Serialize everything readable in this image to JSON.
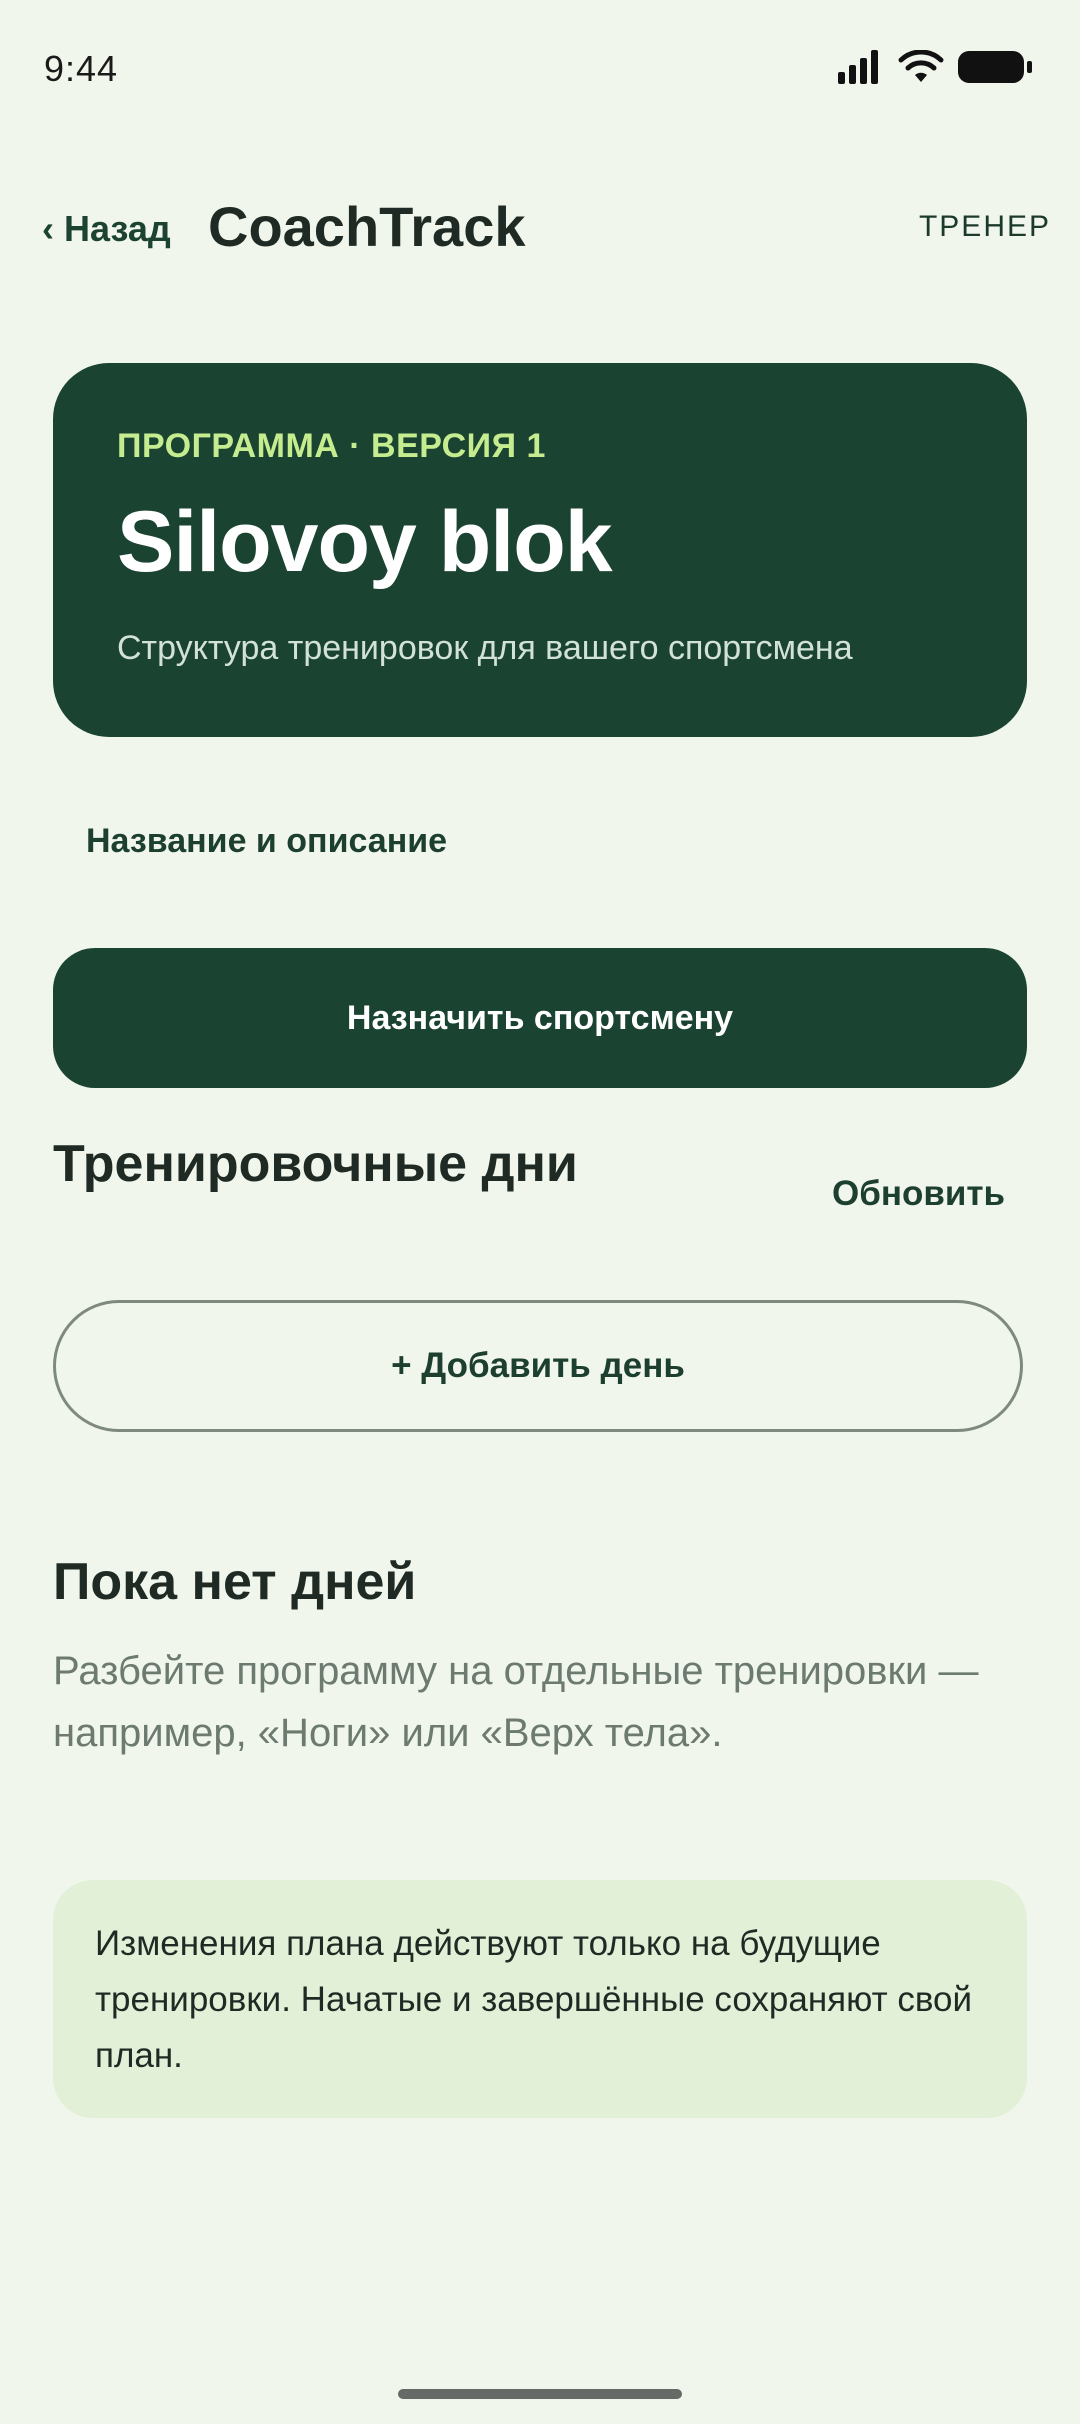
{
  "status_bar": {
    "time": "9:44",
    "icons": [
      "signal-icon",
      "wifi-icon",
      "battery-icon"
    ]
  },
  "header": {
    "back_label": "‹ Назад",
    "app_title": "CoachTrack",
    "role_label": "ТРЕНЕР"
  },
  "program_card": {
    "eyebrow": "ПРОГРАММА · ВЕРСИЯ 1",
    "title": "Silovoy blok",
    "subtitle": "Структура тренировок для вашего спортсмена"
  },
  "actions": {
    "edit_link": "Название и описание",
    "assign_button": "Назначить спортсмену"
  },
  "training_days": {
    "section_title": "Тренировочные дни",
    "refresh_label": "Обновить",
    "add_day_label": "+ Добавить день"
  },
  "empty_state": {
    "title": "Пока нет дней",
    "text": "Разбейте программу на отдельные тренировки — например, «Ноги» или «Верх тела»."
  },
  "info_note": {
    "text": "Изменения плана действуют только на будущие тренировки. Начатые и завершённые сохраняют свой план."
  },
  "colors": {
    "background": "#f0f6ec",
    "primary": "#1a4331",
    "accent": "#c5ec8f",
    "note_background": "#e2f0d8"
  }
}
